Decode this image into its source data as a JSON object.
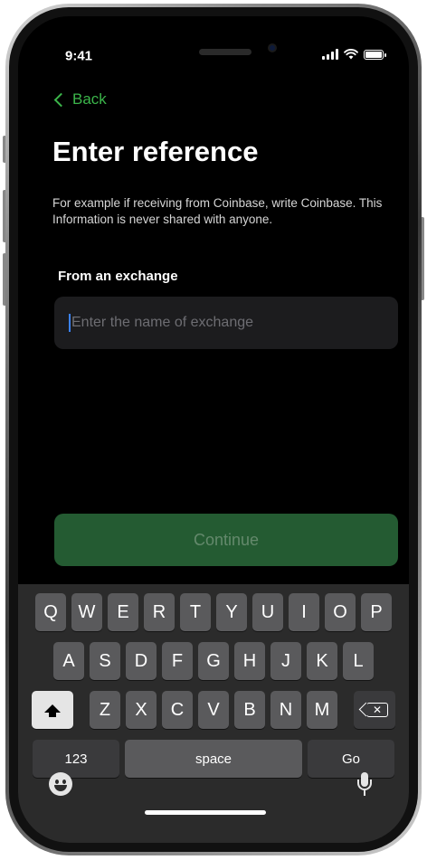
{
  "status_bar": {
    "time": "9:41"
  },
  "nav": {
    "back_label": "Back"
  },
  "page": {
    "title": "Enter reference",
    "description": "For example if receiving from Coinbase, write Coinbase. This Information is never shared with anyone.",
    "field_label": "From an exchange",
    "input_value": "",
    "input_placeholder": "Enter the name of exchange",
    "continue_label": "Continue"
  },
  "keyboard": {
    "row1": [
      "Q",
      "W",
      "E",
      "R",
      "T",
      "Y",
      "U",
      "I",
      "O",
      "P"
    ],
    "row2": [
      "A",
      "S",
      "D",
      "F",
      "G",
      "H",
      "J",
      "K",
      "L"
    ],
    "row3": [
      "Z",
      "X",
      "C",
      "V",
      "B",
      "N",
      "M"
    ],
    "numbers_label": "123",
    "space_label": "space",
    "go_label": "Go"
  },
  "colors": {
    "accent": "#3bb54a",
    "button_bg": "#245b32",
    "button_text": "#64896c",
    "input_bg": "#1c1c1e",
    "background": "#000000"
  },
  "icons": {
    "back": "chevron-left-icon",
    "shift": "shift-icon",
    "backspace": "backspace-icon",
    "emoji": "emoji-icon",
    "mic": "microphone-icon"
  }
}
